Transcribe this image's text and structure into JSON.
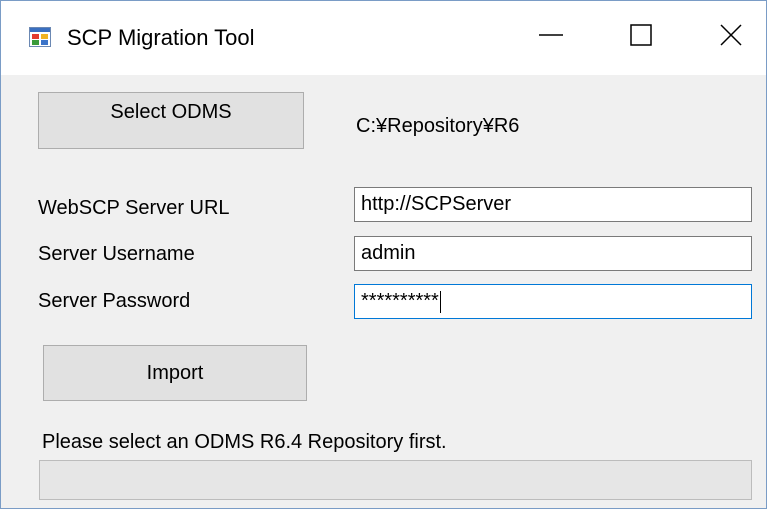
{
  "window": {
    "title": "SCP Migration Tool",
    "app_icon": "winforms-app-icon",
    "controls": {
      "minimize_icon": "minimize-icon",
      "maximize_icon": "maximize-icon",
      "close_icon": "close-icon"
    }
  },
  "odms": {
    "select_button_label": "Select ODMS",
    "path": "C:¥Repository¥R6"
  },
  "form": {
    "url_label": "WebSCP Server URL",
    "url_value": "http://SCPServer",
    "username_label": "Server Username",
    "username_value": "admin",
    "password_label": "Server Password",
    "password_value": "**********"
  },
  "actions": {
    "import_label": "Import"
  },
  "status": {
    "message": "Please select an ODMS R6.4 Repository first.",
    "progress": 0
  },
  "colors": {
    "window_border": "#7a9cc6",
    "focus_border": "#0078d7",
    "button_face": "#e1e1e1",
    "form_background": "#f0f0f0"
  }
}
